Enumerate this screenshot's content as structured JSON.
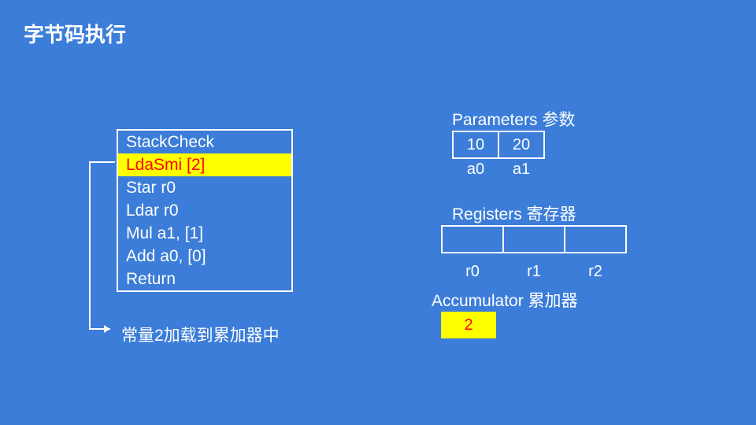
{
  "title": "字节码执行",
  "bytecode": [
    {
      "text": "StackCheck",
      "active": false
    },
    {
      "text": "LdaSmi [2]",
      "active": true
    },
    {
      "text": "Star r0",
      "active": false
    },
    {
      "text": "Ldar r0",
      "active": false
    },
    {
      "text": "Mul a1, [1]",
      "active": false
    },
    {
      "text": "Add a0, [0]",
      "active": false
    },
    {
      "text": "Return",
      "active": false
    }
  ],
  "annotation": "常量2加载到累加器中",
  "parameters": {
    "label": "Parameters 参数",
    "cells": [
      {
        "name": "a0",
        "value": "10"
      },
      {
        "name": "a1",
        "value": "20"
      }
    ]
  },
  "registers": {
    "label": "Registers 寄存器",
    "cells": [
      {
        "name": "r0",
        "value": ""
      },
      {
        "name": "r1",
        "value": ""
      },
      {
        "name": "r2",
        "value": ""
      }
    ]
  },
  "accumulator": {
    "label": "Accumulator 累加器",
    "value": "2"
  }
}
